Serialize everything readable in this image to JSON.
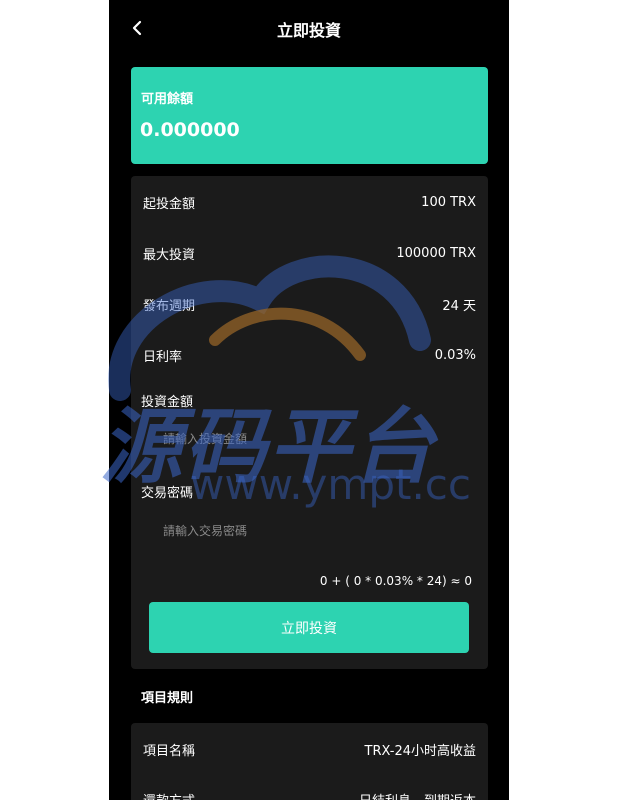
{
  "header": {
    "title": "立即投資"
  },
  "balance": {
    "label": "可用餘額",
    "value": "0.000000"
  },
  "details": [
    {
      "key": "起投金額",
      "value": "100 TRX"
    },
    {
      "key": "最大投資",
      "value": "100000 TRX"
    },
    {
      "key": "發布週期",
      "value": "24 天"
    },
    {
      "key": "日利率",
      "value": "0.03%"
    }
  ],
  "investment": {
    "amount_label": "投資金額",
    "amount_placeholder": "請輸入投資金額",
    "password_label": "交易密碼",
    "password_placeholder": "請輸入交易密碼",
    "formula": "0 + ( 0 * 0.03% * 24) ≈ 0",
    "submit_label": "立即投資"
  },
  "rules": {
    "title": "項目規則",
    "items": [
      {
        "key": "項目名稱",
        "value": "TRX-24小时高收益"
      },
      {
        "key": "還款方式",
        "value": "日結利息，到期返本"
      }
    ]
  },
  "watermark": {
    "text": "源码平台",
    "url": "www.ympt.cc"
  },
  "colors": {
    "accent": "#2dd3b1",
    "background": "#000000",
    "panel": "#1b1b1b"
  },
  "icons": {
    "back": "chevron-left-icon"
  }
}
